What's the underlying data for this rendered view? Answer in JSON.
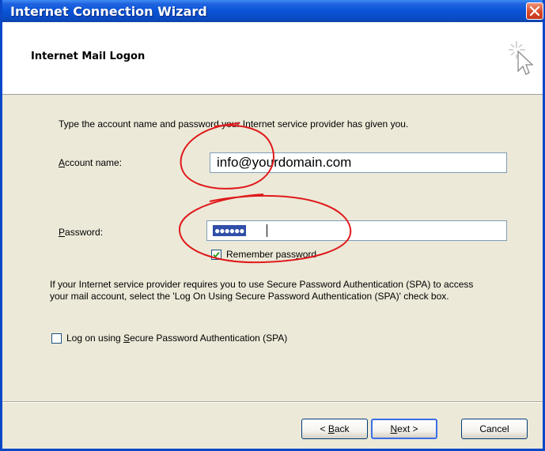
{
  "window": {
    "title": "Internet Connection Wizard"
  },
  "header": {
    "title": "Internet Mail Logon"
  },
  "body": {
    "intro": "Type the account name and password your Internet service provider has given you.",
    "account_label_first": "A",
    "account_label_rest": "ccount name:",
    "account_value": "info@yourdomain.com",
    "password_label_first": "P",
    "password_label_rest": "assword:",
    "password_mask": "●●●●●●",
    "remember_pre": "Remember pass",
    "remember_u": "w",
    "remember_post": "ord",
    "remember_checked": true,
    "spa_paragraph": "If your Internet service provider requires you to use Secure Password Authentication (SPA) to access your mail account, select the 'Log On Using Secure Password Authentication (SPA)' check box.",
    "spa_pre": "Log on using ",
    "spa_u": "S",
    "spa_post": "ecure Password Authentication (SPA)",
    "spa_checked": false
  },
  "buttons": {
    "back_pre": "< ",
    "back_u": "B",
    "back_post": "ack",
    "next_u": "N",
    "next_post": "ext >",
    "cancel": "Cancel"
  },
  "colors": {
    "titlebar": "#0a54d8",
    "annotation": "#e0191b"
  }
}
